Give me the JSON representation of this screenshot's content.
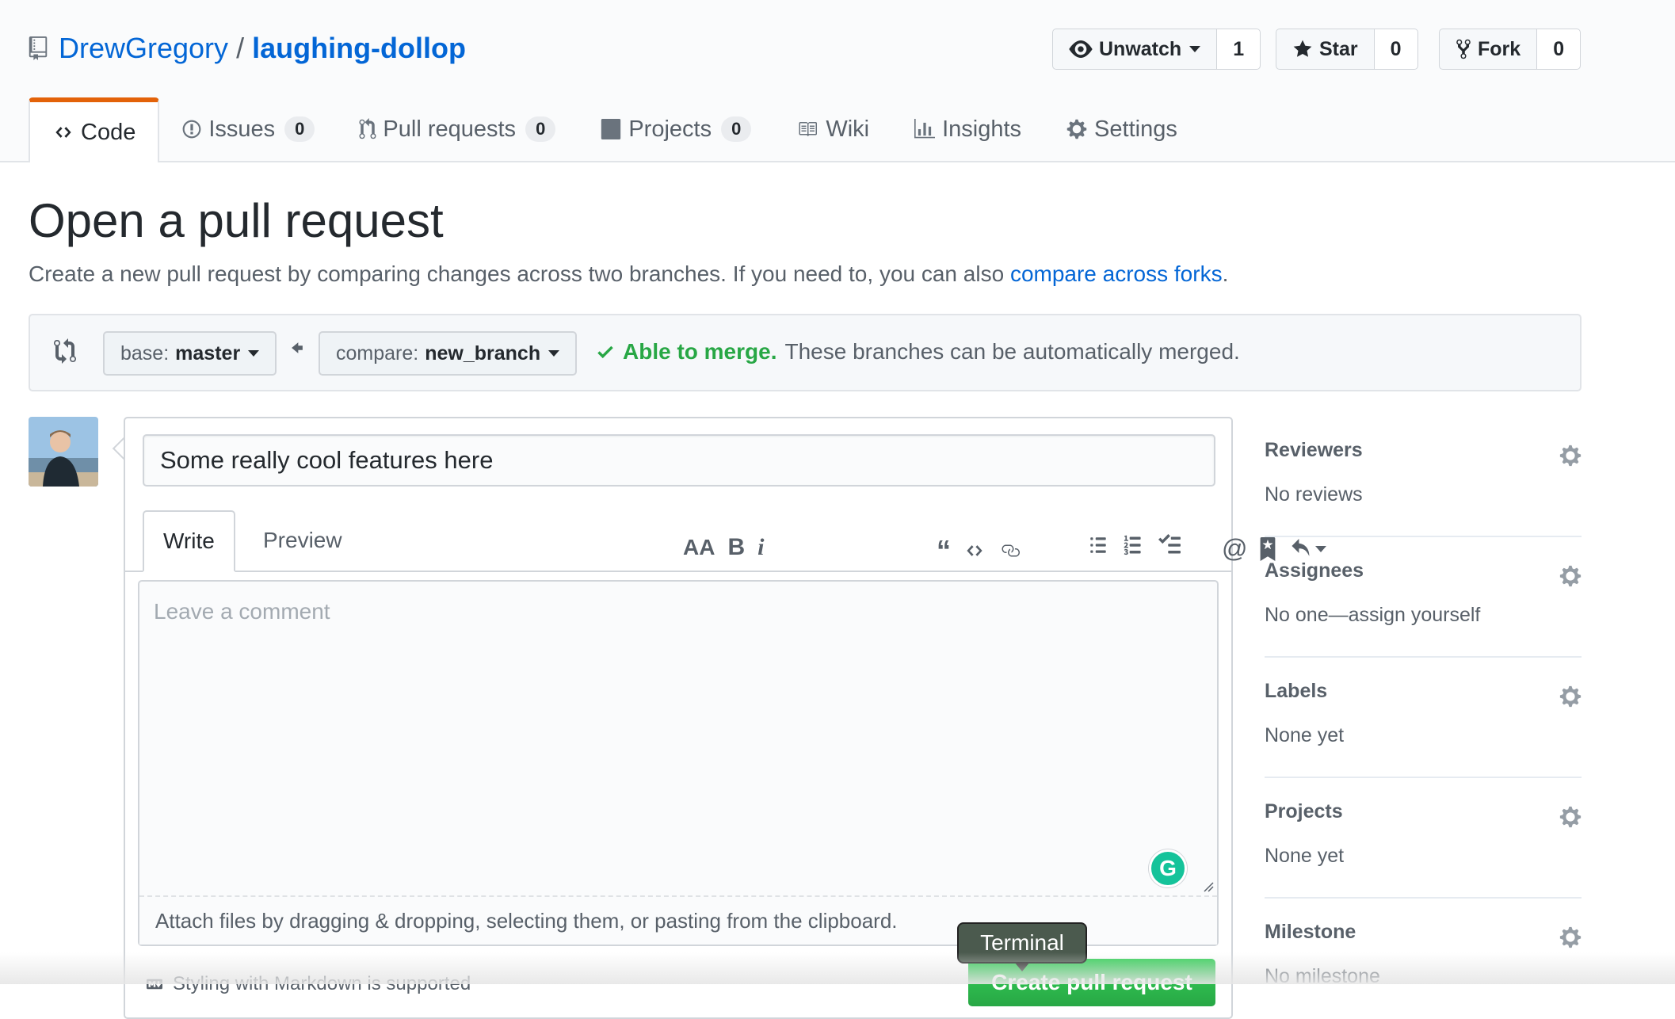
{
  "repo": {
    "owner": "DrewGregory",
    "separator": "/",
    "name": "laughing-dollop"
  },
  "actions": {
    "watch": {
      "label": "Unwatch",
      "count": "1"
    },
    "star": {
      "label": "Star",
      "count": "0"
    },
    "fork": {
      "label": "Fork",
      "count": "0"
    }
  },
  "tabs": [
    {
      "label": "Code"
    },
    {
      "label": "Issues",
      "count": "0"
    },
    {
      "label": "Pull requests",
      "count": "0"
    },
    {
      "label": "Projects",
      "count": "0"
    },
    {
      "label": "Wiki"
    },
    {
      "label": "Insights"
    },
    {
      "label": "Settings"
    }
  ],
  "page": {
    "title": "Open a pull request",
    "subtitle_text": "Create a new pull request by comparing changes across two branches. If you need to, you can also ",
    "subtitle_link": "compare across forks",
    "subtitle_end": "."
  },
  "compare": {
    "base_prefix": "base:",
    "base_branch": "master",
    "compare_prefix": "compare:",
    "compare_branch": "new_branch",
    "merge_status": "Able to merge.",
    "merge_message": "These branches can be automatically merged."
  },
  "pr": {
    "title_value": "Some really cool features here",
    "tab_write": "Write",
    "tab_preview": "Preview",
    "comment_placeholder": "Leave a comment",
    "attach_hint": "Attach files by dragging & dropping, selecting them, or pasting from the clipboard.",
    "markdown_hint": "Styling with Markdown is supported",
    "create_button": "Create pull request",
    "grammarly": "G"
  },
  "tooltip": "Terminal",
  "sidebar": [
    {
      "title": "Reviewers",
      "value": "No reviews"
    },
    {
      "title": "Assignees",
      "value": "No one—assign yourself"
    },
    {
      "title": "Labels",
      "value": "None yet"
    },
    {
      "title": "Projects",
      "value": "None yet"
    },
    {
      "title": "Milestone",
      "value": "No milestone"
    }
  ],
  "colors": {
    "link": "#0366d6",
    "accent_tab": "#e36209",
    "merge_ok": "#28a745",
    "create_btn": "#2cbe4e"
  }
}
